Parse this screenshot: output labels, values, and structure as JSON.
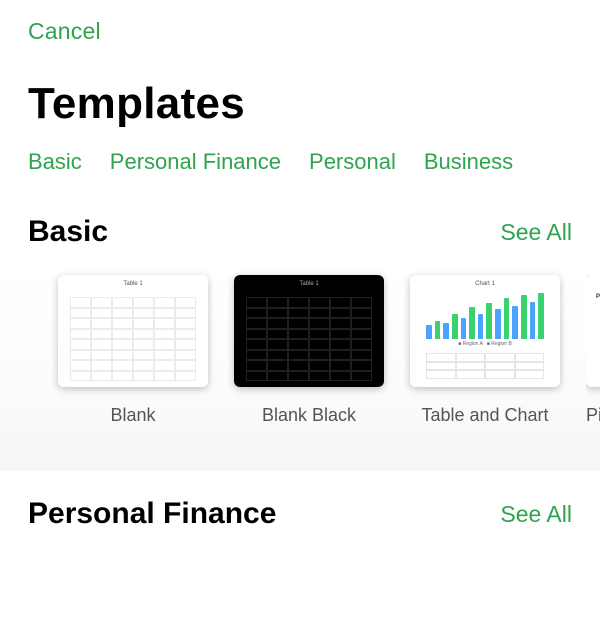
{
  "nav": {
    "cancel": "Cancel"
  },
  "title": "Templates",
  "tabs": {
    "items": [
      {
        "label": "Basic"
      },
      {
        "label": "Personal Finance"
      },
      {
        "label": "Personal"
      },
      {
        "label": "Business"
      }
    ]
  },
  "sections": {
    "basic": {
      "title": "Basic",
      "see_all": "See All",
      "templates": [
        {
          "label": "Blank"
        },
        {
          "label": "Blank Black"
        },
        {
          "label": "Table and Chart"
        },
        {
          "label": "Piv"
        }
      ]
    },
    "personal_finance": {
      "title": "Personal Finance",
      "see_all": "See All"
    }
  },
  "colors": {
    "accent": "#2ea44f"
  }
}
